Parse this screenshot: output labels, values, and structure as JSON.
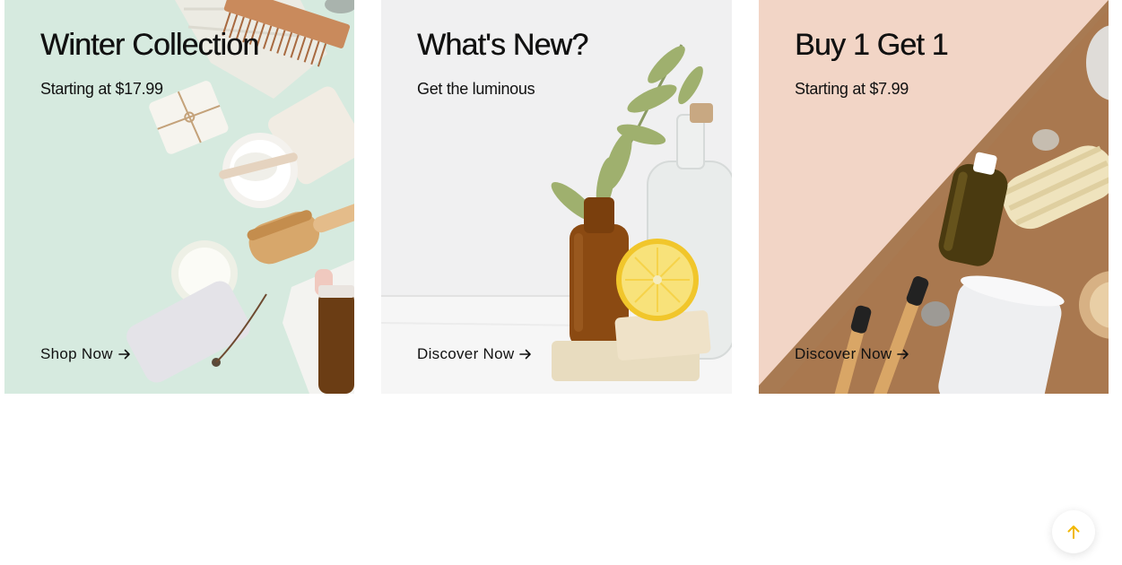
{
  "cards": [
    {
      "title": "Winter Collection",
      "subtitle": "Starting at $17.99",
      "link_label": "Shop Now",
      "link_icon": "arrow-right-icon",
      "background": "#d4e8dc"
    },
    {
      "title": "What's New?",
      "subtitle": "Get the luminous",
      "link_label": "Discover Now",
      "link_icon": "arrow-right-icon",
      "background": "#f1f1f1"
    },
    {
      "title": "Buy 1 Get 1",
      "subtitle": "Starting at $7.99",
      "link_label": "Discover Now",
      "link_icon": "arrow-right-icon",
      "background": "#f3d9cc"
    }
  ],
  "scroll_top": {
    "icon": "arrow-up-icon",
    "accent": "#f2b800"
  }
}
